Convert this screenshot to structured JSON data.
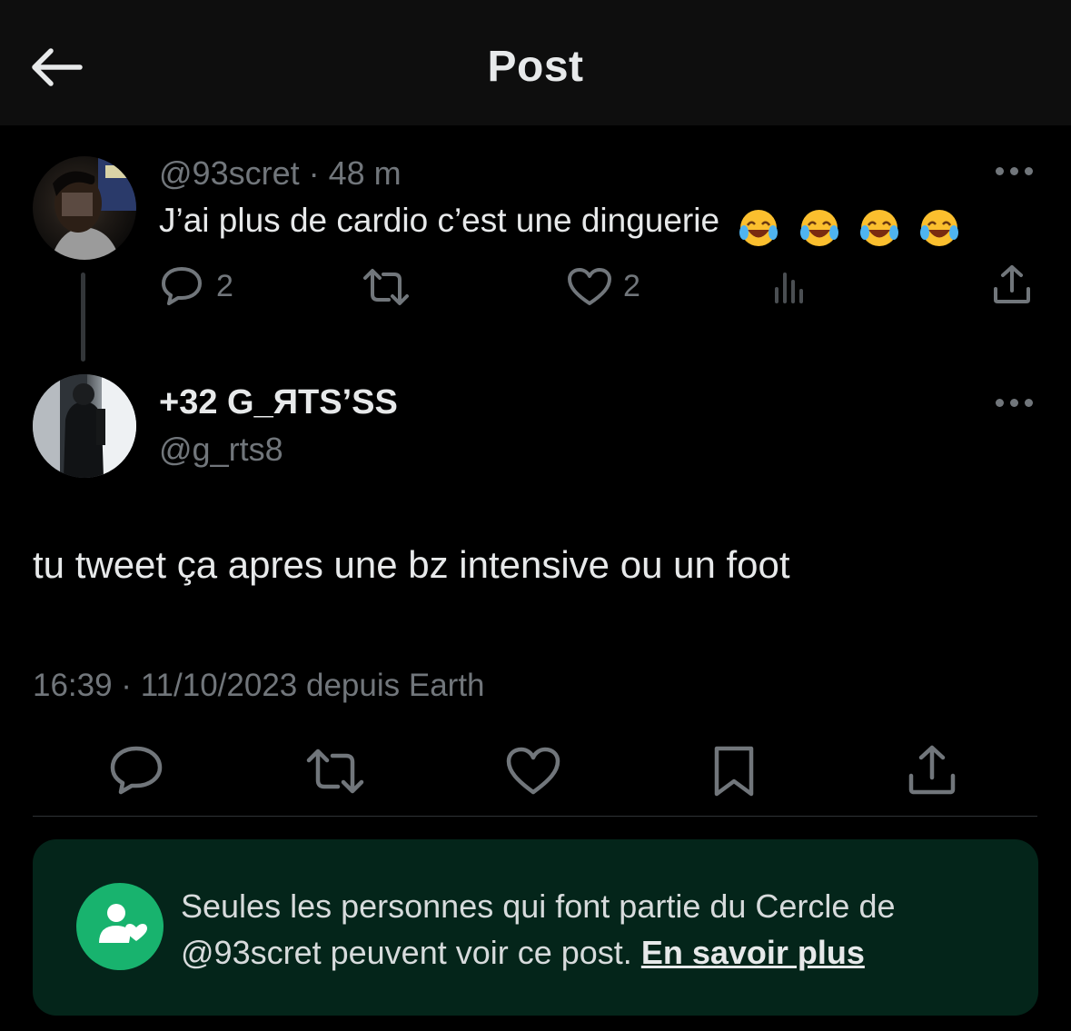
{
  "header": {
    "title": "Post",
    "back_icon": "arrow-left-icon"
  },
  "parent_post": {
    "handle": "@93scret",
    "separator": "·",
    "time": "48 m",
    "text": "J’ai plus de cardio c’est une dinguerie",
    "emojis": [
      "face-with-tears-of-joy",
      "face-with-tears-of-joy",
      "face-with-tears-of-joy",
      "face-with-tears-of-joy"
    ],
    "reply_count": "2",
    "like_count": "2",
    "icons": [
      "reply-icon",
      "repost-icon",
      "like-icon",
      "views-icon",
      "share-icon"
    ]
  },
  "main_post": {
    "display_name": "+32 G_ЯTS’SS",
    "handle": "@g_rts8",
    "text": "tu tweet ça apres une bz intensive ou un foot",
    "timestamp": "16:39 · 11/10/2023 depuis Earth",
    "icons": [
      "reply-icon",
      "repost-icon",
      "like-icon",
      "bookmark-icon",
      "share-icon"
    ]
  },
  "circle_notice": {
    "text_line1": "Seules les personnes qui font partie du Cercle de",
    "text_line2": "@93scret peuvent voir ce post.",
    "link": "En savoir plus",
    "icon": "circle-people-icon"
  },
  "colors": {
    "background": "#000000",
    "header_bg": "#0e0e0e",
    "secondary_text": "#71767b",
    "primary_text": "#e7e9ea",
    "notice_bg": "#04251a",
    "notice_icon": "#18b36e"
  }
}
